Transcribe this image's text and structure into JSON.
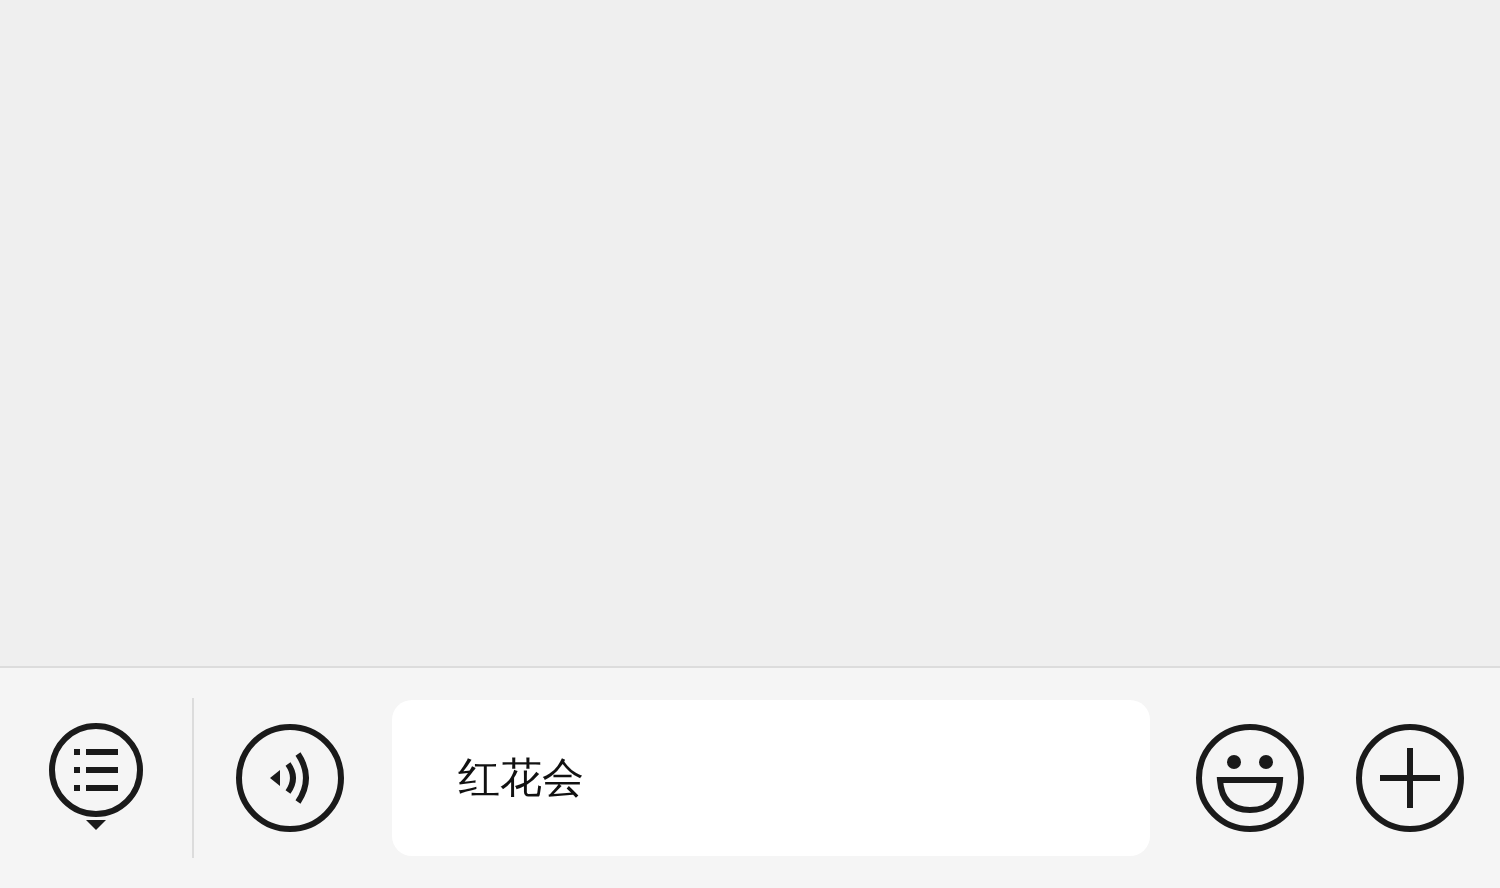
{
  "message_input": {
    "value": "红花会"
  }
}
